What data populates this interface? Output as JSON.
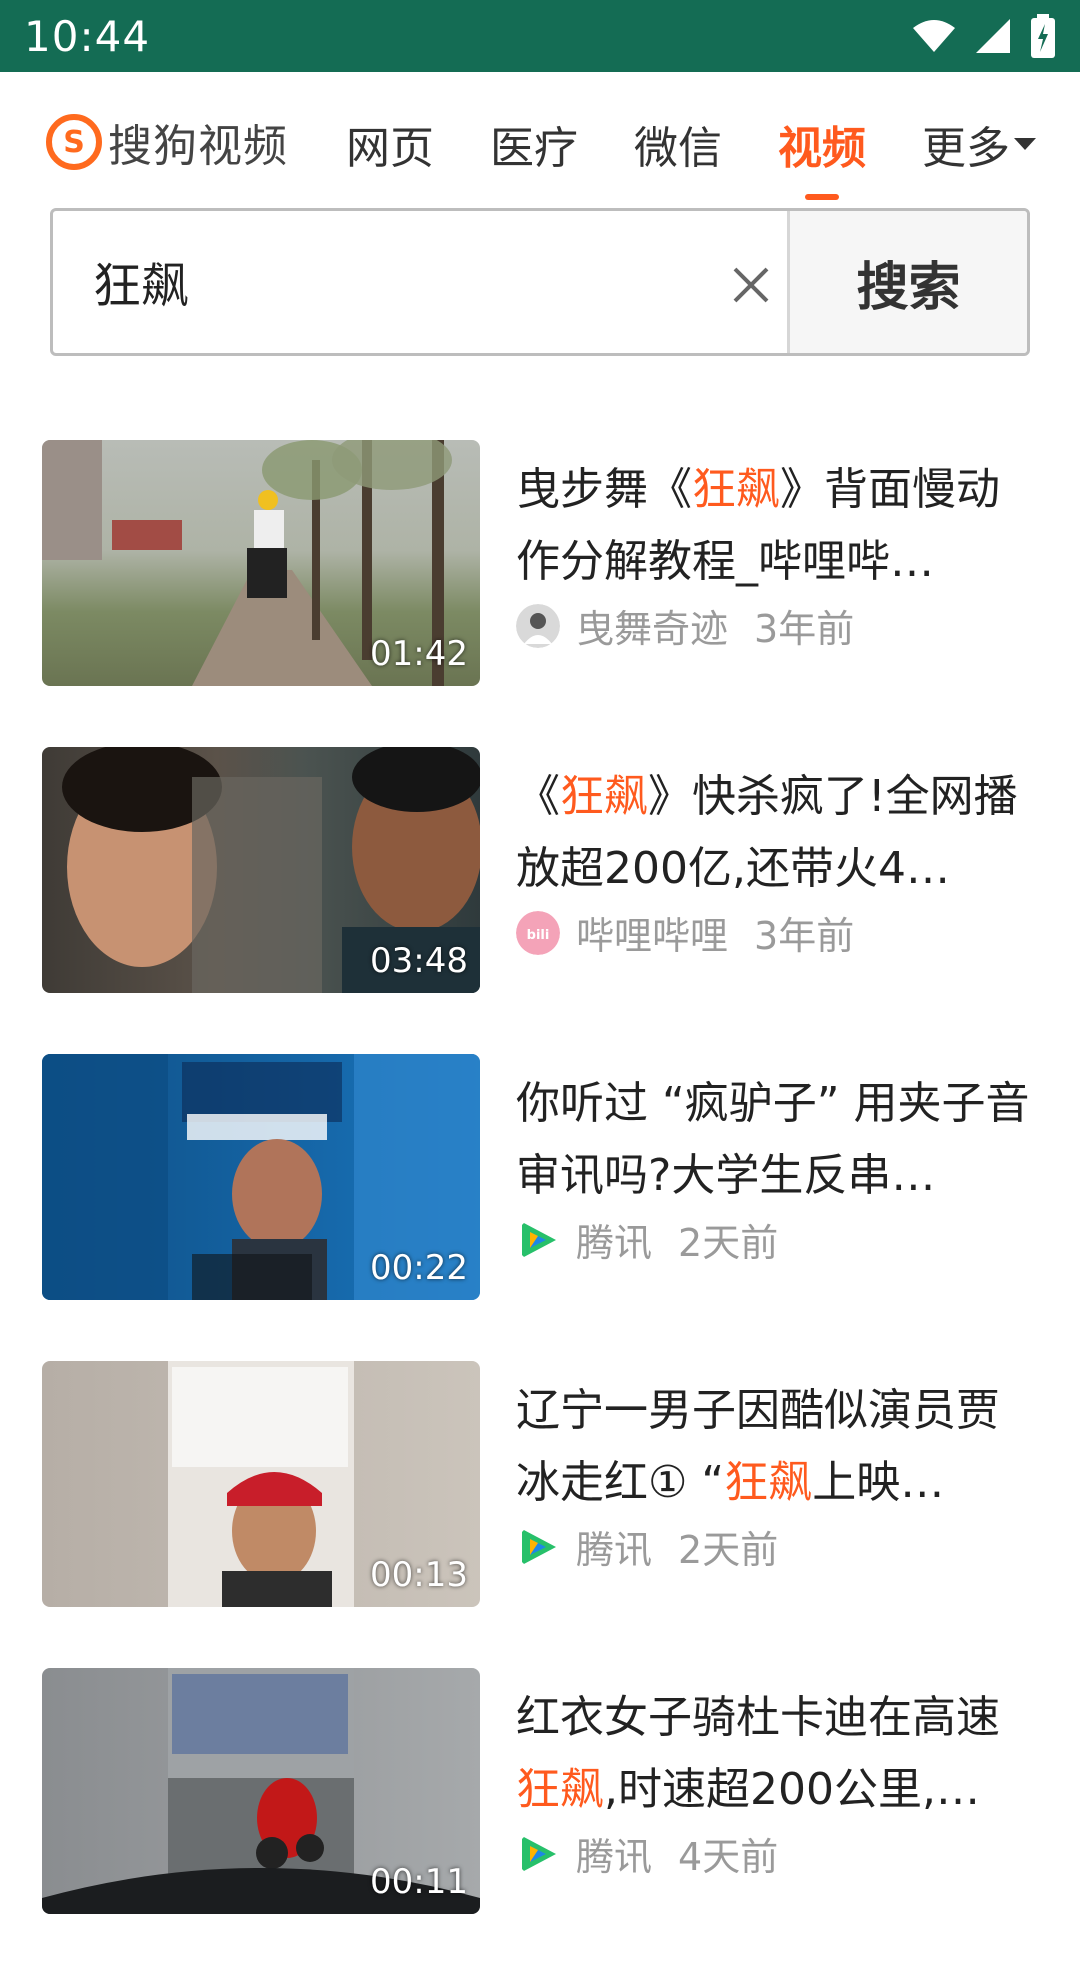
{
  "status_bar": {
    "time": "10:44"
  },
  "header": {
    "logo_text": "搜狗视频",
    "tabs": [
      {
        "label": "网页",
        "active": false
      },
      {
        "label": "医疗",
        "active": false
      },
      {
        "label": "微信",
        "active": false
      },
      {
        "label": "视频",
        "active": true
      },
      {
        "label": "更多",
        "active": false
      }
    ]
  },
  "search": {
    "query": "狂飙",
    "button_label": "搜索"
  },
  "colors": {
    "accent": "#ff5a1e",
    "status_bar": "#146c54"
  },
  "results": [
    {
      "title_parts": [
        "曳步舞《",
        "狂飙",
        "》背面慢动作分解教程_哔哩哔…"
      ],
      "source": "曳舞奇迹",
      "time": "3年前",
      "duration": "01:42",
      "source_icon": "avatar-icon"
    },
    {
      "title_parts": [
        "《",
        "狂飙",
        "》快杀疯了!全网播放超200亿,还带火4…"
      ],
      "source": "哔哩哔哩",
      "time": "3年前",
      "duration": "03:48",
      "source_icon": "bilibili-icon"
    },
    {
      "title_parts": [
        "你听过 “疯驴子” 用夹子音审讯吗?大学生反串…",
        "",
        ""
      ],
      "source": "腾讯",
      "time": "2天前",
      "duration": "00:22",
      "source_icon": "tencent-video-icon"
    },
    {
      "title_parts": [
        "辽宁一男子因酷似演员贾冰走红① “",
        "狂飙",
        "上映…"
      ],
      "source": "腾讯",
      "time": "2天前",
      "duration": "00:13",
      "source_icon": "tencent-video-icon"
    },
    {
      "title_parts": [
        "红衣女子骑杜卡迪在高速",
        "狂飙",
        ",时速超200公里,…"
      ],
      "source": "腾讯",
      "time": "4天前",
      "duration": "00:11",
      "source_icon": "tencent-video-icon"
    }
  ]
}
